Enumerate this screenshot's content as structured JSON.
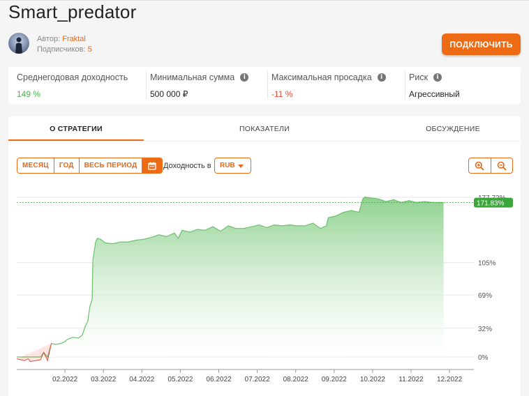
{
  "strategy": {
    "title": "Smart_predator",
    "author_label": "Автор:",
    "author_name": "Fraktal",
    "subscribers_label": "Подписчиков:",
    "subscribers_count": "5",
    "connect_label": "ПОДКЛЮЧИТЬ"
  },
  "stats": [
    {
      "label": "Среднегодовая доходность",
      "value": "149 %",
      "color": "#4caf50",
      "info": false
    },
    {
      "label": "Минимальная сумма",
      "value": "500 000 ₽",
      "color": "#222222",
      "info": true
    },
    {
      "label": "Максимальная просадка",
      "value": "-11 %",
      "color": "#e74c3c",
      "info": true
    },
    {
      "label": "Риск",
      "value": "Агрессивный",
      "color": "#222222",
      "info": true
    }
  ],
  "tabs": [
    {
      "label": "О СТРАТЕГИИ",
      "active": true
    },
    {
      "label": "ПОКАЗАТЕЛИ",
      "active": false
    },
    {
      "label": "ОБСУЖДЕНИЕ",
      "active": false
    }
  ],
  "controls": {
    "periods": [
      "МЕСЯЦ",
      "ГОД",
      "ВЕСЬ ПЕРИОД"
    ],
    "calendar_icon": "calendar-icon",
    "yield_label": "Доходность в",
    "currency": "RUB",
    "zoom_in_icon": "zoom-in-icon",
    "zoom_out_icon": "zoom-out-icon"
  },
  "colors": {
    "accent": "#ed6b15",
    "positive": "#4caf50",
    "negative": "#e74c3c",
    "area_top": "#8fd18f",
    "current_badge": "#3aa53a"
  },
  "chart_data": {
    "type": "area",
    "y_ticks": [
      "177.72%",
      "105%",
      "69%",
      "32%",
      "0%"
    ],
    "y_tick_values": [
      177.72,
      105,
      69,
      32,
      0
    ],
    "x_ticks": [
      "02.2022",
      "03.2022",
      "04.2022",
      "05.2022",
      "06.2022",
      "07.2022",
      "08.2022",
      "09.2022",
      "10.2022",
      "11.2022",
      "12.2022"
    ],
    "current_value": 171.83,
    "current_label": "171.83%",
    "ylim": [
      0,
      177.72
    ],
    "grid": true,
    "series": [
      {
        "x": [
          0.0,
          0.1,
          0.2,
          0.3,
          0.35,
          0.5,
          0.62,
          0.7,
          0.8,
          0.9,
          1.0,
          1.15,
          1.25,
          1.3,
          1.45,
          1.6,
          1.7,
          1.78,
          1.85,
          1.9,
          1.96,
          1.98,
          2.05,
          2.1,
          2.18,
          2.3,
          2.5,
          2.7,
          2.9,
          3.1,
          3.3,
          3.5,
          3.7,
          3.9,
          4.1,
          4.2,
          4.3,
          4.5,
          4.7,
          4.9,
          5.1,
          5.3,
          5.5,
          5.7,
          5.9,
          6.1,
          6.3,
          6.5,
          6.7,
          6.9,
          7.1,
          7.3,
          7.5,
          7.7,
          7.9,
          8.05,
          8.1,
          8.3,
          8.5,
          8.7,
          8.9,
          9.0,
          9.05,
          9.2,
          9.4,
          9.6,
          9.8,
          10.0,
          10.2,
          10.4,
          10.6,
          10.8,
          11.0,
          11.1
        ],
        "y": [
          -2,
          -3,
          -4,
          -2,
          -5,
          -4,
          -3,
          5,
          -4,
          15,
          14,
          15,
          17,
          19,
          22,
          21,
          24,
          34,
          40,
          56,
          64,
          108,
          128,
          132,
          131,
          127,
          126,
          128,
          128,
          130,
          131,
          133,
          136,
          134,
          138,
          132,
          141,
          139,
          142,
          141,
          145,
          140,
          146,
          143,
          143,
          145,
          147,
          144,
          147,
          146,
          147,
          146,
          146,
          149,
          143,
          146,
          155,
          157,
          161,
          163,
          161,
          176,
          178,
          177,
          176,
          173,
          175,
          172,
          174,
          172,
          173,
          172,
          172,
          171.83
        ]
      }
    ]
  }
}
